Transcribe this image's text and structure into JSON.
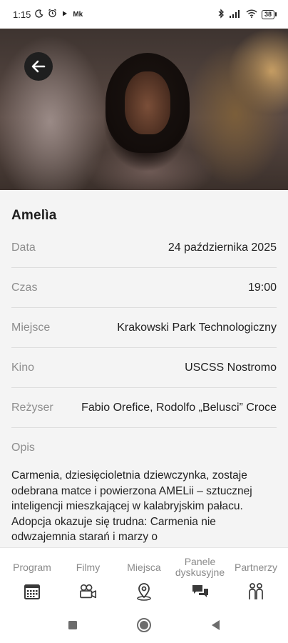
{
  "status_bar": {
    "time": "1:15",
    "carrier_icons": [
      "moon-icon",
      "alarm-icon",
      "play-icon",
      "mk-icon"
    ],
    "carrier_text": "Mk",
    "battery": "38",
    "right_icons": [
      "bluetooth-icon",
      "signal-icon",
      "wifi-icon",
      "battery-icon"
    ]
  },
  "event": {
    "title": "Amelìa",
    "details": [
      {
        "label": "Data",
        "value": "24 października 2025"
      },
      {
        "label": "Czas",
        "value": "19:00"
      },
      {
        "label": "Miejsce",
        "value": "Krakowski Park Technologiczny"
      },
      {
        "label": "Kino",
        "value": "USCSS Nostromo"
      },
      {
        "label": "Reżyser",
        "value": "Fabio Orefice, Rodolfo „Belusci” Croce"
      }
    ],
    "description_label": "Opis",
    "description": "Carmenia, dziesięcioletnia dziewczynka, zostaje odebrana matce i powierzona AMELii – sztucznej inteligencji mieszkającej w kalabryjskim pałacu. Adopcja okazuje się trudna: Carmenia nie odwzajemnia starań i marzy o"
  },
  "bottom_nav": {
    "items": [
      {
        "label": "Program",
        "icon": "calendar-icon"
      },
      {
        "label": "Filmy",
        "icon": "camera-icon"
      },
      {
        "label": "Miejsca",
        "icon": "location-pin-icon"
      },
      {
        "label": "Panele dyskusyjne",
        "icon": "chat-bubbles-icon"
      },
      {
        "label": "Partnerzy",
        "icon": "people-icon"
      }
    ]
  },
  "system_nav": {
    "icons": [
      "recents-icon",
      "home-icon",
      "back-icon"
    ]
  },
  "colors": {
    "accent_dark": "#1f1f1f",
    "label_gray": "#8e8e8e",
    "divider": "#dedede",
    "background": "#f4f4f4"
  }
}
